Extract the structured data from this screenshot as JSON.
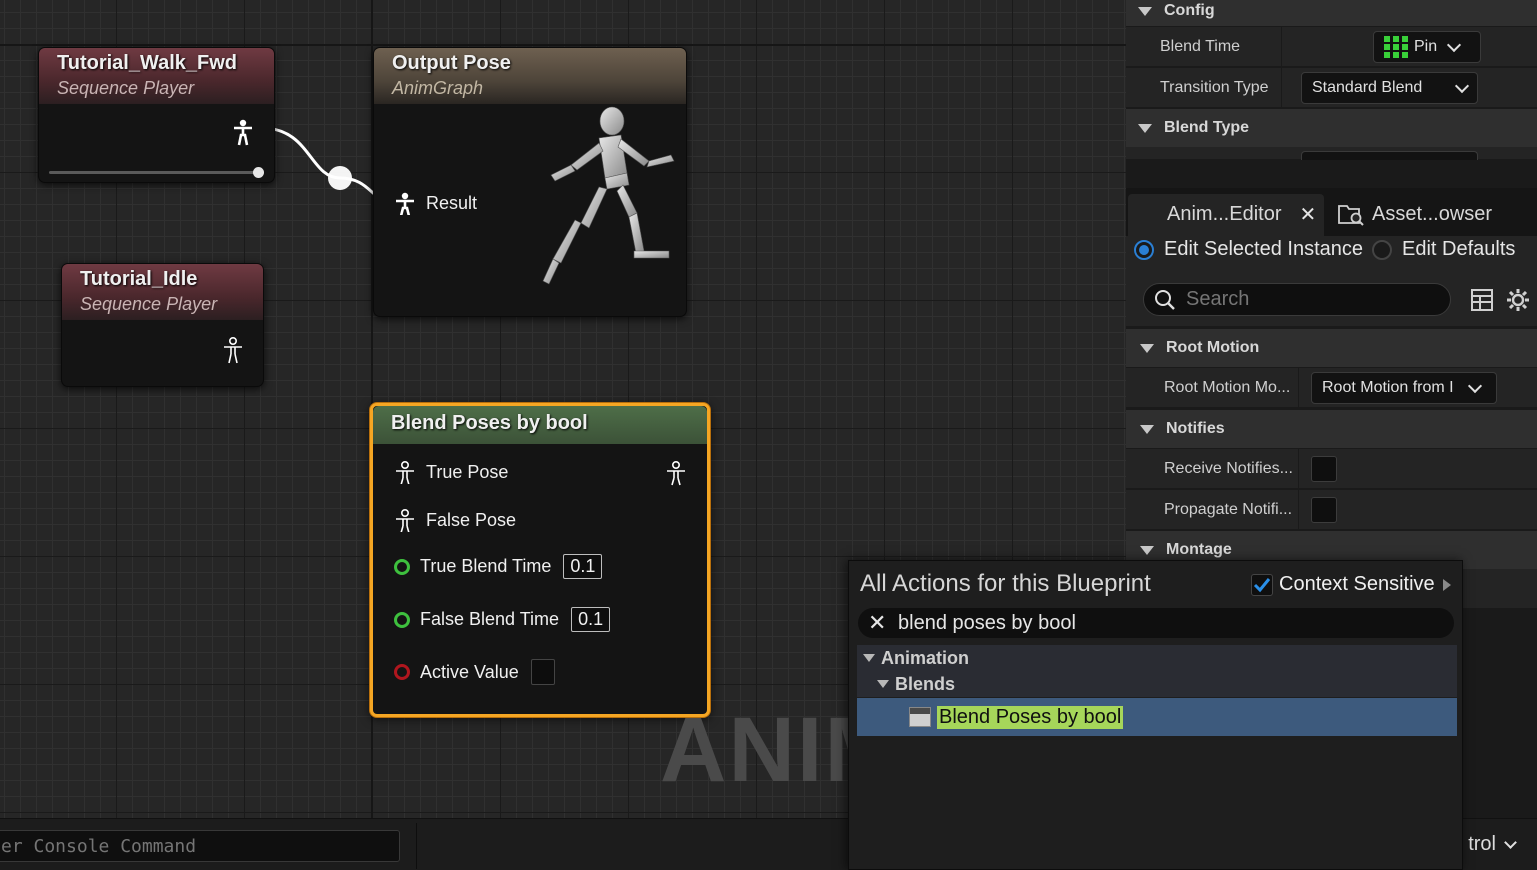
{
  "graph": {
    "nodes": {
      "walk": {
        "title": "Tutorial_Walk_Fwd",
        "subtitle": "Sequence Player"
      },
      "output": {
        "title": "Output Pose",
        "subtitle": "AnimGraph",
        "pin_result": "Result"
      },
      "idle": {
        "title": "Tutorial_Idle",
        "subtitle": "Sequence Player"
      },
      "blend": {
        "title": "Blend Poses by bool",
        "pins": {
          "true_pose": "True Pose",
          "false_pose": "False Pose",
          "true_blend_time": "True Blend Time",
          "false_blend_time": "False Blend Time",
          "active_value": "Active Value"
        },
        "true_blend_value": "0.1",
        "false_blend_value": "0.1"
      }
    },
    "watermark": "ANIM"
  },
  "bottom_bar": {
    "console_placeholder": "er Console Command",
    "control_label": "trol"
  },
  "details": {
    "config": {
      "header": "Config",
      "blend_time_label": "Blend Time",
      "blend_time_value": "Pin",
      "transition_type_label": "Transition Type",
      "transition_type_value": "Standard Blend"
    },
    "blend_type": {
      "header": "Blend Type"
    }
  },
  "tabs": {
    "anim_editor": "Anim...Editor",
    "asset_browser": "Asset...owser"
  },
  "instance_toggle": {
    "selected": "Edit Selected Instance",
    "defaults": "Edit Defaults"
  },
  "search": {
    "placeholder": "Search"
  },
  "sections": {
    "root_motion": {
      "header": "Root Motion",
      "mode_label": "Root Motion Mo...",
      "mode_value": "Root Motion from I"
    },
    "notifies": {
      "header": "Notifies",
      "receive_label": "Receive Notifies...",
      "propagate_label": "Propagate Notifi..."
    },
    "montage": {
      "header": "Montage"
    }
  },
  "action_menu": {
    "title": "All Actions for this Blueprint",
    "context_sensitive_label": "Context Sensitive",
    "context_sensitive_checked": true,
    "search_value": "blend poses by bool",
    "tree": {
      "category": "Animation",
      "subcategory": "Blends",
      "item": "Blend Poses by bool"
    }
  },
  "colors": {
    "selection_highlight": "#f5a623",
    "match_highlight": "#a6d65a",
    "selected_row": "#3d5a7d",
    "accent_blue": "#2a7fd4"
  }
}
